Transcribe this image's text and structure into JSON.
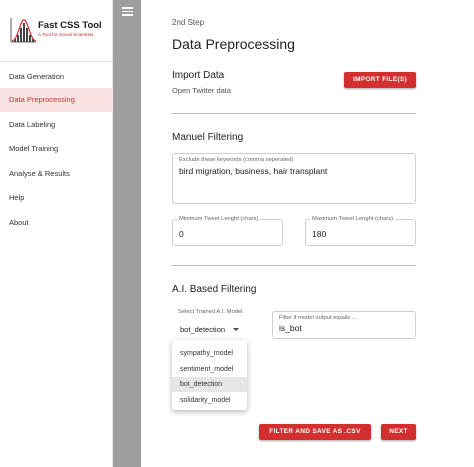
{
  "brand": {
    "name": "Fast CSS Tool",
    "tagline": "A Tool for Social Scientists",
    "accent_color": "#d32f2f",
    "icon": "bell-curve-chart-icon"
  },
  "sidebar": {
    "items": [
      {
        "label": "Data Generation",
        "active": false
      },
      {
        "label": "Data Preprocessing",
        "active": true
      },
      {
        "label": "Data Labeling",
        "active": false
      },
      {
        "label": "Model Training",
        "active": false
      },
      {
        "label": "Analyse & Results",
        "active": false
      },
      {
        "label": "Help",
        "active": false
      },
      {
        "label": "About",
        "active": false
      }
    ]
  },
  "toolbar": {
    "menu_icon": "hamburger-menu-icon"
  },
  "header": {
    "step": "2nd Step",
    "title": "Data Preprocessing"
  },
  "import_section": {
    "title": "Import Data",
    "subtitle": "Open Twitter data",
    "button_label": "IMPORT FILE(S)"
  },
  "manual_filtering": {
    "title": "Manuel Filtering",
    "keywords": {
      "label": "Exclude these keywords (comma seperated)",
      "value": "bird migration, business, hair transplant"
    },
    "min_length": {
      "label": "Minimum Tweet Lenght (chars)",
      "value": "0"
    },
    "max_length": {
      "label": "Maximum Tweet Lenght (chars)",
      "value": "180"
    }
  },
  "ai_filtering": {
    "title": "A.I. Based Filtering",
    "model_select": {
      "label": "Select Trained A.I. Model",
      "value": "bot_detection",
      "options": [
        "sympathy_model",
        "sentiment_model",
        "bot_detection",
        "solidarity_model"
      ],
      "highlighted_index": 2
    },
    "output_filter": {
      "label": "Filter if model output equals ...",
      "value": "is_bot"
    }
  },
  "actions": {
    "filter_label": "FILTER AND SAVE AS .CSV",
    "next_label": "NEXT"
  }
}
